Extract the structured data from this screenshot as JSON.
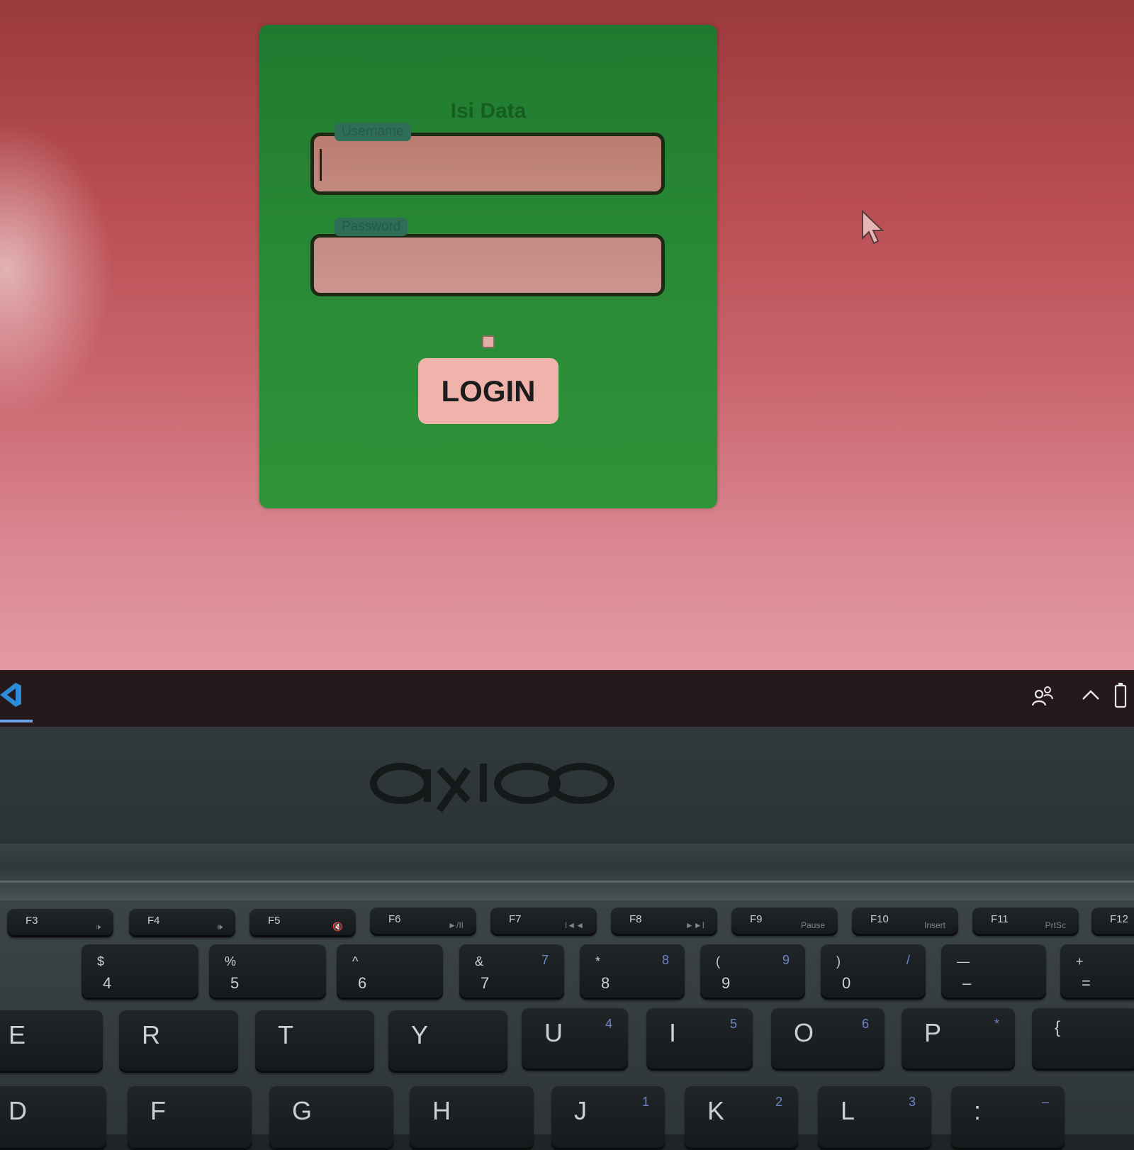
{
  "form": {
    "title": "Isi Data",
    "username_label": "Username",
    "username_value": "",
    "password_label": "Password",
    "password_value": "",
    "login_label": "LOGIN"
  },
  "colors": {
    "page_background": "#c95e66",
    "card_background": "#2a8a36",
    "button_background": "#f0b3ac"
  },
  "taskbar": {
    "pinned_app_icon": "visual-studio-code-icon",
    "tray_icons": [
      "people-icon",
      "chevron-up-icon",
      "battery-icon"
    ]
  },
  "laptop": {
    "brand": "axioo",
    "function_keys": [
      {
        "label": "F3",
        "sub": "🕩"
      },
      {
        "label": "F4",
        "sub": "🕪"
      },
      {
        "label": "F5",
        "sub": "🔇"
      },
      {
        "label": "F6",
        "sub": "►/II"
      },
      {
        "label": "F7",
        "sub": "I◄◄"
      },
      {
        "label": "F8",
        "sub": "►►I"
      },
      {
        "label": "F9",
        "sub": "Pause"
      },
      {
        "label": "F10",
        "sub": "Insert"
      },
      {
        "label": "F11",
        "sub": "PrtSc"
      },
      {
        "label": "F12",
        "sub": ""
      }
    ],
    "number_keys": [
      {
        "top": "$",
        "bottom": "4",
        "alt": ""
      },
      {
        "top": "%",
        "bottom": "5",
        "alt": ""
      },
      {
        "top": "^",
        "bottom": "6",
        "alt": ""
      },
      {
        "top": "&",
        "bottom": "7",
        "alt": "7"
      },
      {
        "top": "*",
        "bottom": "8",
        "alt": "8"
      },
      {
        "top": "(",
        "bottom": "9",
        "alt": "9"
      },
      {
        "top": ")",
        "bottom": "0",
        "alt": "/"
      },
      {
        "top": "—",
        "bottom": "–",
        "alt": ""
      },
      {
        "top": "+",
        "bottom": "=",
        "alt": ""
      }
    ],
    "letter_row_1": [
      {
        "main": "E",
        "alt": ""
      },
      {
        "main": "R",
        "alt": ""
      },
      {
        "main": "T",
        "alt": ""
      },
      {
        "main": "Y",
        "alt": ""
      },
      {
        "main": "U",
        "alt": "4"
      },
      {
        "main": "I",
        "alt": "5"
      },
      {
        "main": "O",
        "alt": "6"
      },
      {
        "main": "P",
        "alt": "*"
      },
      {
        "main": "{",
        "alt": ""
      }
    ],
    "letter_row_2": [
      {
        "main": "D",
        "alt": ""
      },
      {
        "main": "F",
        "alt": ""
      },
      {
        "main": "G",
        "alt": ""
      },
      {
        "main": "H",
        "alt": ""
      },
      {
        "main": "J",
        "alt": "1"
      },
      {
        "main": "K",
        "alt": "2"
      },
      {
        "main": "L",
        "alt": "3"
      },
      {
        "main": ":",
        "alt": "–"
      }
    ]
  }
}
